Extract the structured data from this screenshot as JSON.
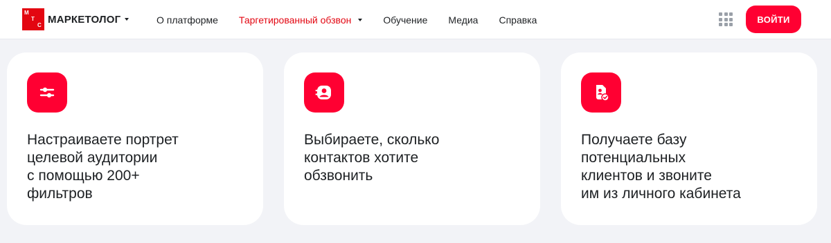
{
  "header": {
    "logo": {
      "glyphs": [
        "М",
        "Т",
        "С"
      ],
      "text": "МАРКЕТОЛОГ"
    },
    "nav": [
      {
        "label": "О платформе"
      },
      {
        "label": "Таргетированный обзвон"
      },
      {
        "label": "Обучение"
      },
      {
        "label": "Медиа"
      },
      {
        "label": "Справка"
      }
    ],
    "apps_icon": "apps-grid-icon",
    "login_label": "ВОЙТИ"
  },
  "cards": [
    {
      "icon": "sliders-icon",
      "lines": [
        "Настраиваете портрет",
        "целевой аудитории",
        "с помощью 200+",
        "фильтров"
      ]
    },
    {
      "icon": "contact-icon",
      "lines": [
        "Выбираете, сколько",
        "контактов хотите",
        "обзвонить"
      ]
    },
    {
      "icon": "document-check-icon",
      "lines": [
        "Получаете базу",
        "потенциальных",
        "клиентов и звоните",
        "им из личного кабинета"
      ]
    }
  ],
  "colors": {
    "accent": "#ff0032",
    "brand": "#e30611",
    "background": "#f2f3f7",
    "text": "#1d2023"
  }
}
